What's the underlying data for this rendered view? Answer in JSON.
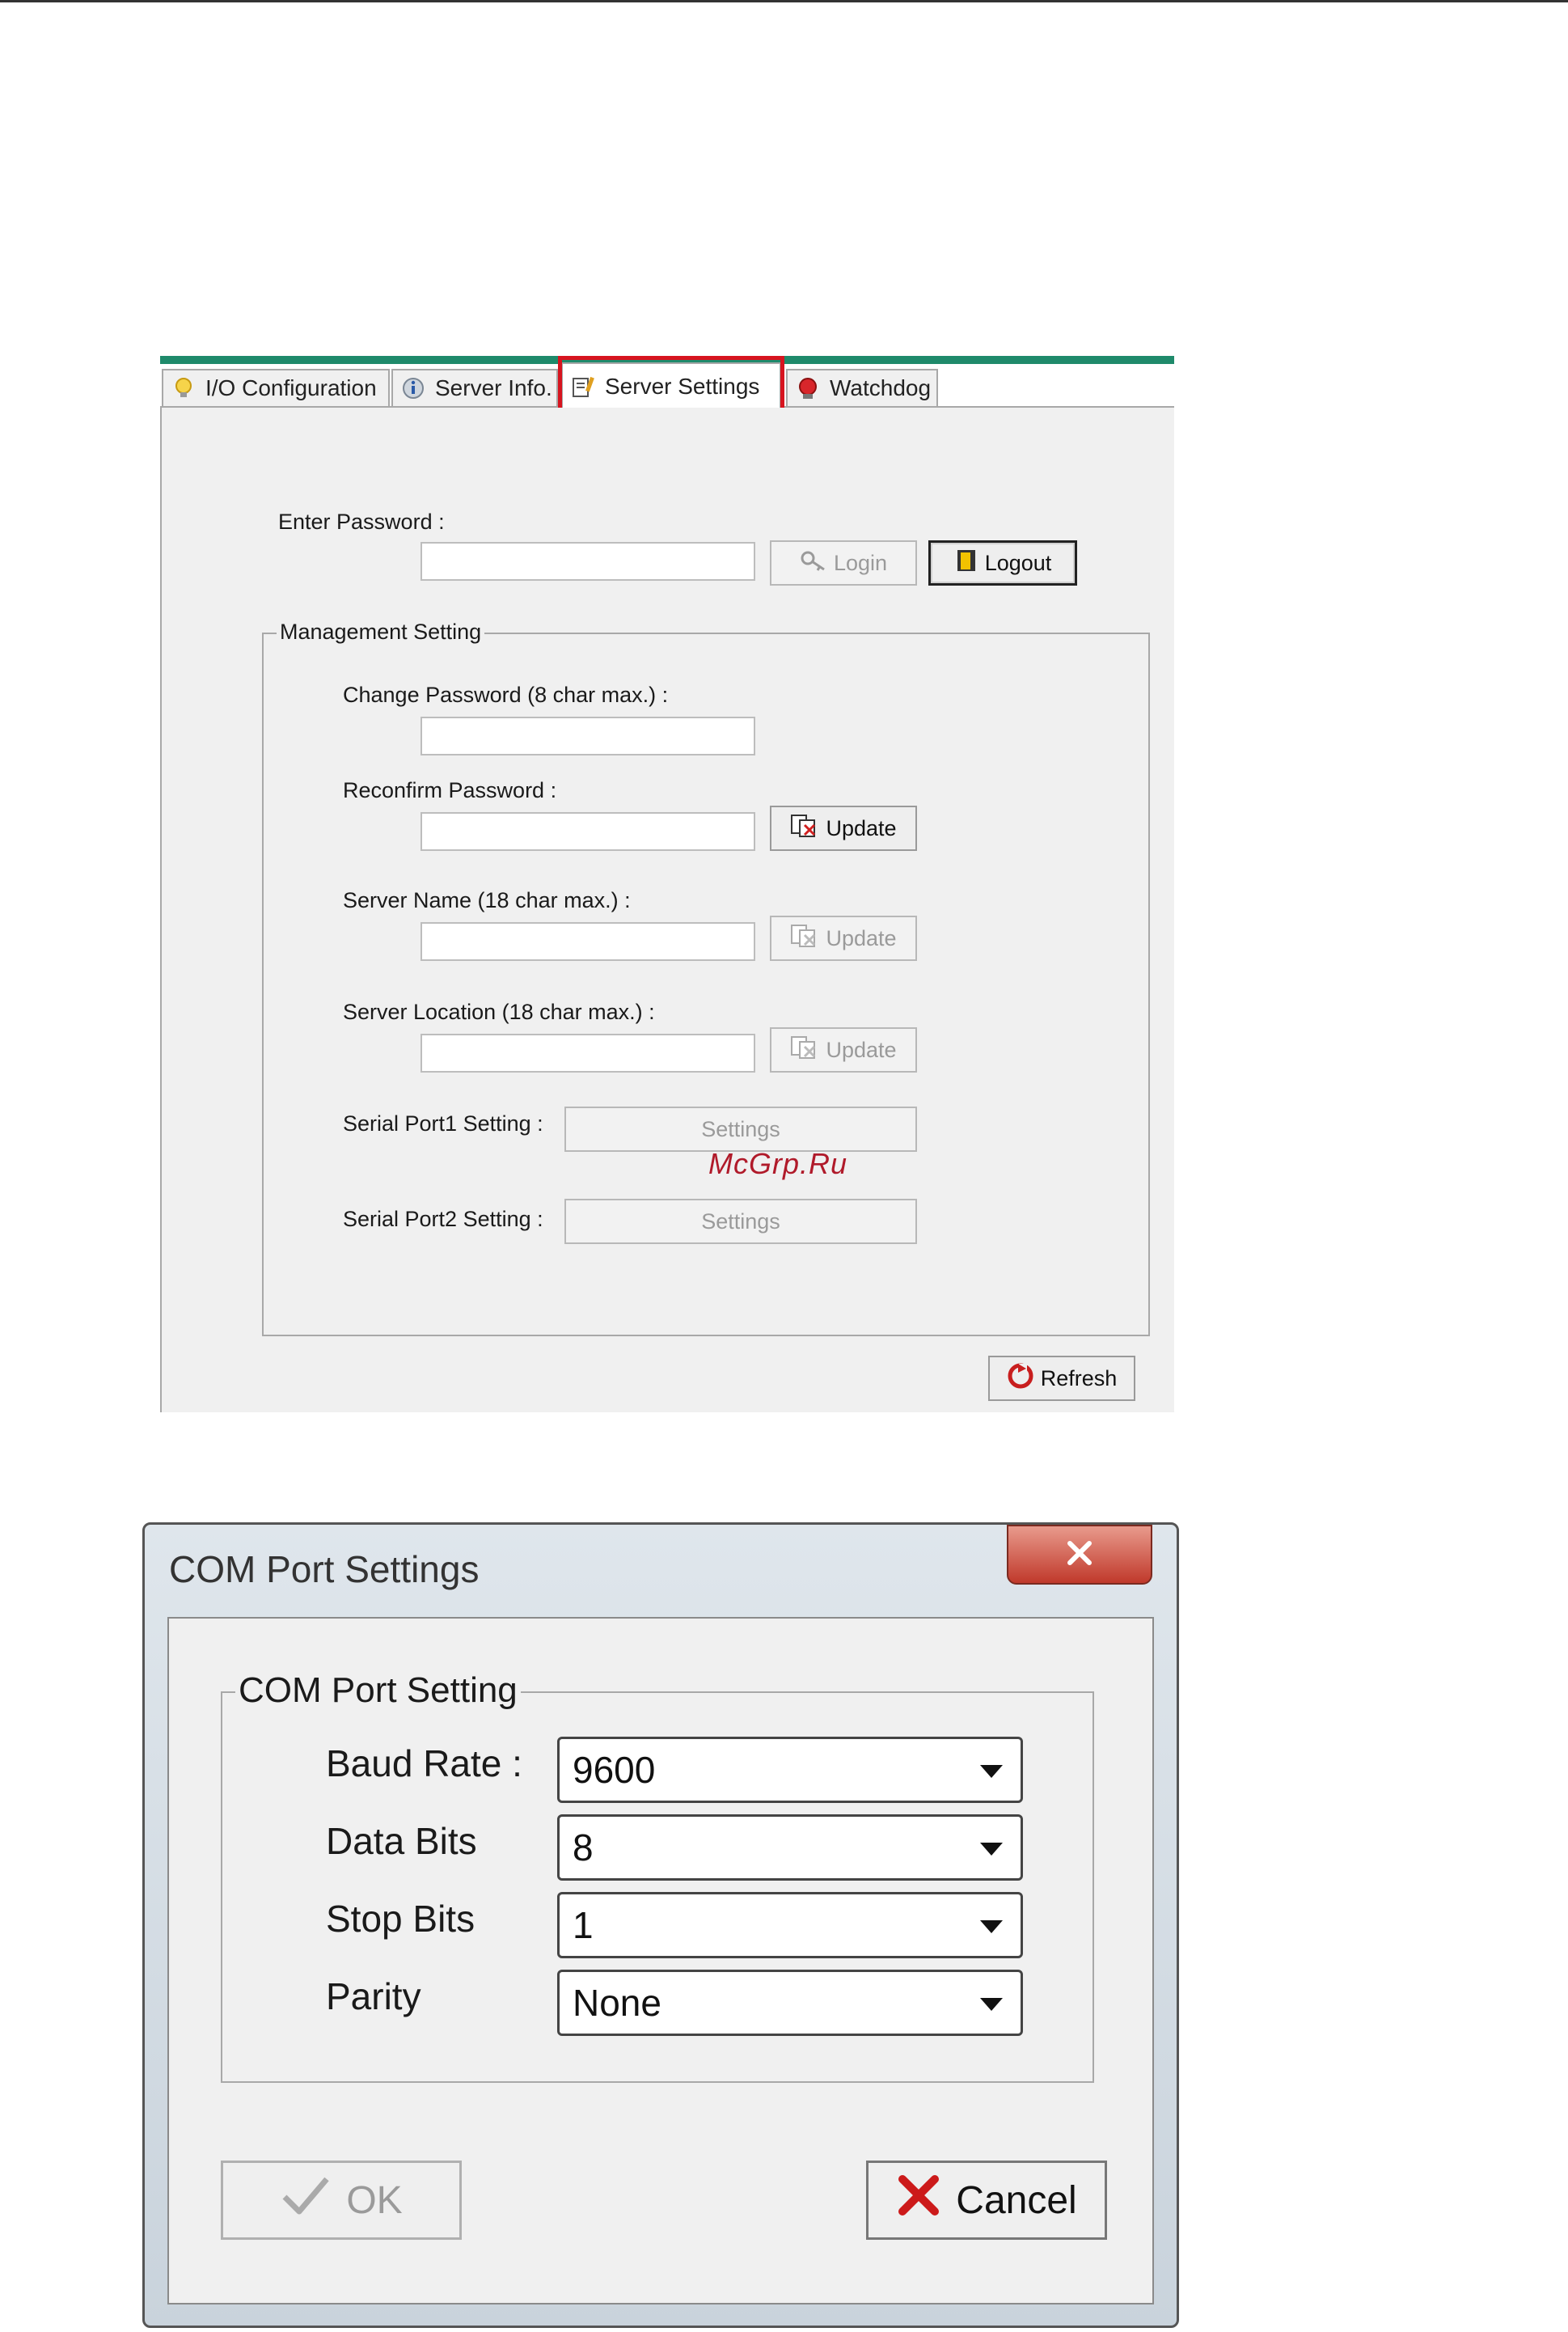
{
  "server_panel": {
    "tabs": [
      {
        "label": "I/O Configuration",
        "icon": "lightbulb-icon"
      },
      {
        "label": "Server Info.",
        "icon": "info-icon"
      },
      {
        "label": "Server Settings",
        "icon": "settings-note-icon"
      },
      {
        "label": "Watchdog",
        "icon": "watchdog-icon"
      }
    ],
    "active_tab": "Server Settings",
    "enter_password_label": "Enter Password :",
    "login_label": "Login",
    "logout_label": "Logout",
    "management_legend": "Management Setting",
    "change_password_label": "Change Password (8 char max.) :",
    "reconfirm_password_label": "Reconfirm Password :",
    "server_name_label": "Server Name (18 char max.) :",
    "server_location_label": "Server Location (18 char max.) :",
    "update_label": "Update",
    "serial_port1_label": "Serial Port1 Setting :",
    "serial_port2_label": "Serial Port2 Setting :",
    "settings_label": "Settings",
    "refresh_label": "Refresh",
    "watermark": "McGrp.Ru",
    "highlight_color": "#d7141f",
    "accent_color": "#1f8a6b"
  },
  "com_dialog": {
    "title": "COM Port Settings",
    "legend": "COM Port Setting",
    "fields": [
      {
        "label": "Baud Rate :",
        "value": "9600"
      },
      {
        "label": "Data Bits",
        "value": "8"
      },
      {
        "label": "Stop Bits",
        "value": "1"
      },
      {
        "label": "Parity",
        "value": "None"
      }
    ],
    "ok_label": "OK",
    "cancel_label": "Cancel",
    "close_icon": "close-icon"
  }
}
